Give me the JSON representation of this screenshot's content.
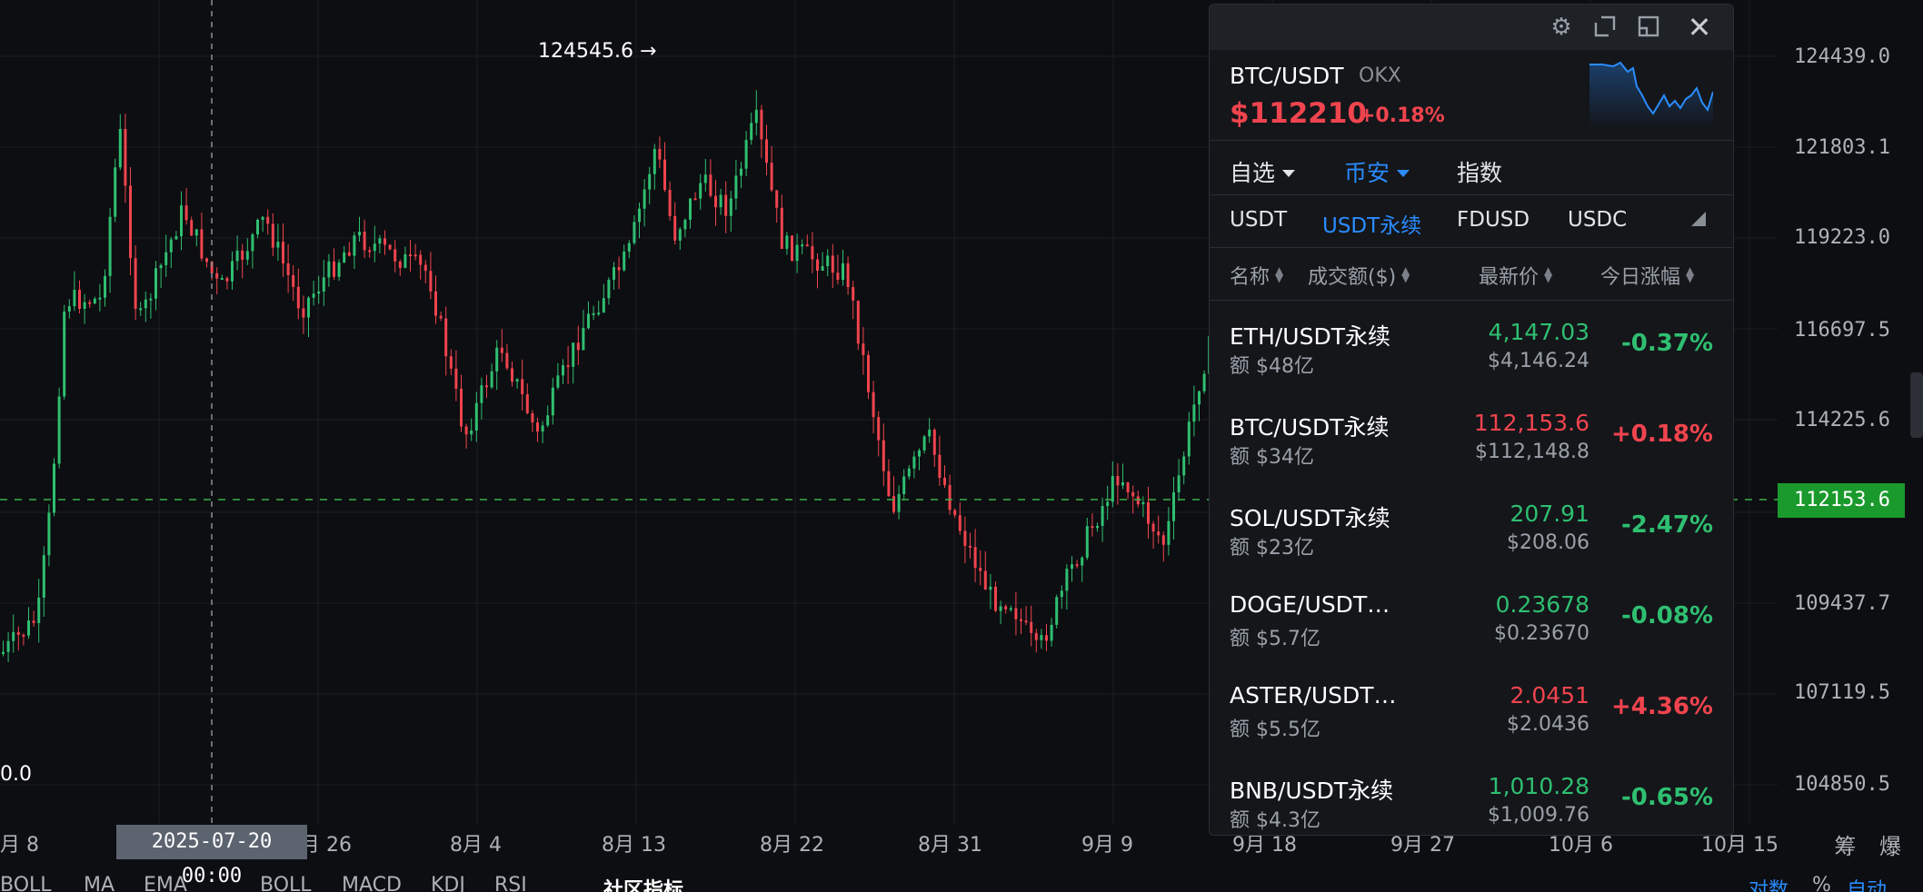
{
  "chart": {
    "max_label": "124545.6 →",
    "left_edge_label": "0.0",
    "current_price_tag": "112153.6",
    "crosshair_time": "2025-07-20 00:00",
    "colors": {
      "up": "#f0444e",
      "down": "#2fbf71",
      "current_line": "#3bb14a",
      "grid": "#1c1f24"
    }
  },
  "price_axis": [
    "124439.0",
    "121803.1",
    "119223.0",
    "116697.5",
    "114225.6",
    "109437.7",
    "107119.5",
    "104850.5"
  ],
  "time_axis": [
    "月 8",
    "月 26",
    "8月 4",
    "8月 13",
    "8月 22",
    "8月 31",
    "9月 9",
    "9月 18",
    "9月 27",
    "10月 6",
    "10月 15"
  ],
  "unit_controls": [
    "筹",
    "爆"
  ],
  "bottom_toolbar": [
    "BOLL",
    "MA",
    "EMA",
    "BOLL",
    "MACD",
    "KDJ",
    "RSI",
    "社区指标",
    "对数",
    "%",
    "自动"
  ],
  "panel": {
    "summary": {
      "pair": "BTC/USDT",
      "exchange": "OKX",
      "price": "$112210",
      "change": "+0.18%"
    },
    "tabs": [
      {
        "label": "自选",
        "active": false
      },
      {
        "label": "币安",
        "active": true
      },
      {
        "label": "指数",
        "active": false
      }
    ],
    "quote_tabs": [
      {
        "label": "USDT",
        "active": false
      },
      {
        "label": "USDT永续",
        "active": true
      },
      {
        "label": "FDUSD",
        "active": false
      },
      {
        "label": "USDC",
        "active": false
      }
    ],
    "columns": [
      "名称",
      "成交额($)",
      "最新价",
      "今日涨幅"
    ],
    "rows": [
      {
        "name": "ETH/USDT永续",
        "volume": "额 $48亿",
        "price": "4,147.03",
        "index": "$4,146.24",
        "change": "-0.37%",
        "dir": "down"
      },
      {
        "name": "BTC/USDT永续",
        "volume": "额 $34亿",
        "price": "112,153.6",
        "index": "$112,148.8",
        "change": "+0.18%",
        "dir": "up"
      },
      {
        "name": "SOL/USDT永续",
        "volume": "额 $23亿",
        "price": "207.91",
        "index": "$208.06",
        "change": "-2.47%",
        "dir": "down"
      },
      {
        "name": "DOGE/USDT…",
        "volume": "额 $5.7亿",
        "price": "0.23678",
        "index": "$0.23670",
        "change": "-0.08%",
        "dir": "down"
      },
      {
        "name": "ASTER/USDT…",
        "volume": "额 $5.5亿",
        "price": "2.0451",
        "index": "$2.0436",
        "change": "+4.36%",
        "dir": "up"
      },
      {
        "name": "BNB/USDT永续",
        "volume": "额 $4.3亿",
        "price": "1,010.28",
        "index": "$1,009.76",
        "change": "-0.65%",
        "dir": "down"
      }
    ]
  }
}
